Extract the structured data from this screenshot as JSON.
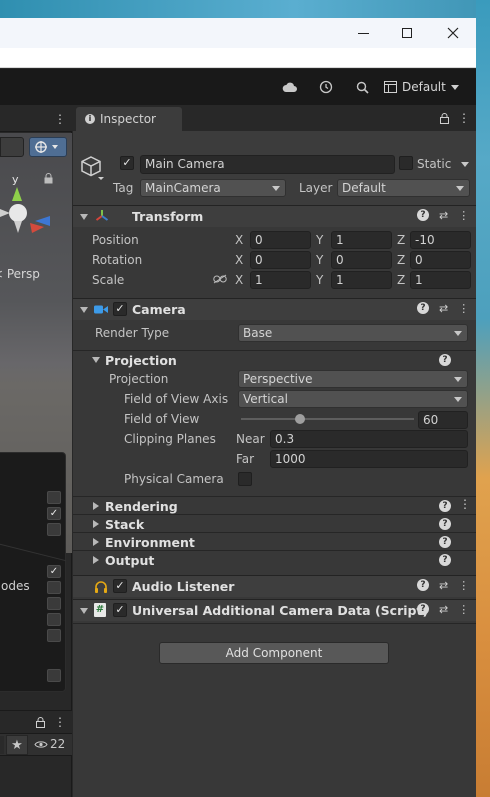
{
  "toolbar": {
    "layout_label": "Default"
  },
  "scene": {
    "persp_label": "< Persp",
    "axis_y": "y",
    "overlay_partial_label": "odes"
  },
  "hierarchy": {
    "count_label": "22"
  },
  "inspector": {
    "tab_label": "Inspector",
    "object": {
      "name": "Main Camera",
      "static_label": "Static",
      "tag_label": "Tag",
      "tag_value": "MainCamera",
      "layer_label": "Layer",
      "layer_value": "Default"
    },
    "transform": {
      "title": "Transform",
      "rows": [
        {
          "label": "Position",
          "x": "0",
          "y": "1",
          "z": "-10"
        },
        {
          "label": "Rotation",
          "x": "0",
          "y": "0",
          "z": "0"
        },
        {
          "label": "Scale",
          "x": "1",
          "y": "1",
          "z": "1"
        }
      ],
      "axis_x": "X",
      "axis_y": "Y",
      "axis_z": "Z"
    },
    "camera": {
      "title": "Camera",
      "render_type_label": "Render Type",
      "render_type_value": "Base",
      "projection_section": "Projection",
      "projection_label": "Projection",
      "projection_value": "Perspective",
      "fov_axis_label": "Field of View Axis",
      "fov_axis_value": "Vertical",
      "fov_label": "Field of View",
      "fov_value": "60",
      "fov_slider_fraction": 0.34,
      "clipping_label": "Clipping Planes",
      "near_label": "Near",
      "near_value": "0.3",
      "far_label": "Far",
      "far_value": "1000",
      "physical_label": "Physical Camera",
      "sections": [
        "Rendering",
        "Stack",
        "Environment",
        "Output"
      ]
    },
    "audio_listener": {
      "title": "Audio Listener"
    },
    "uacd": {
      "title": "Universal Additional Camera Data (Script)"
    },
    "add_component_label": "Add Component"
  },
  "colors": {
    "accent_blue": "#3d7dca",
    "audio_yellow": "#e6a914"
  }
}
